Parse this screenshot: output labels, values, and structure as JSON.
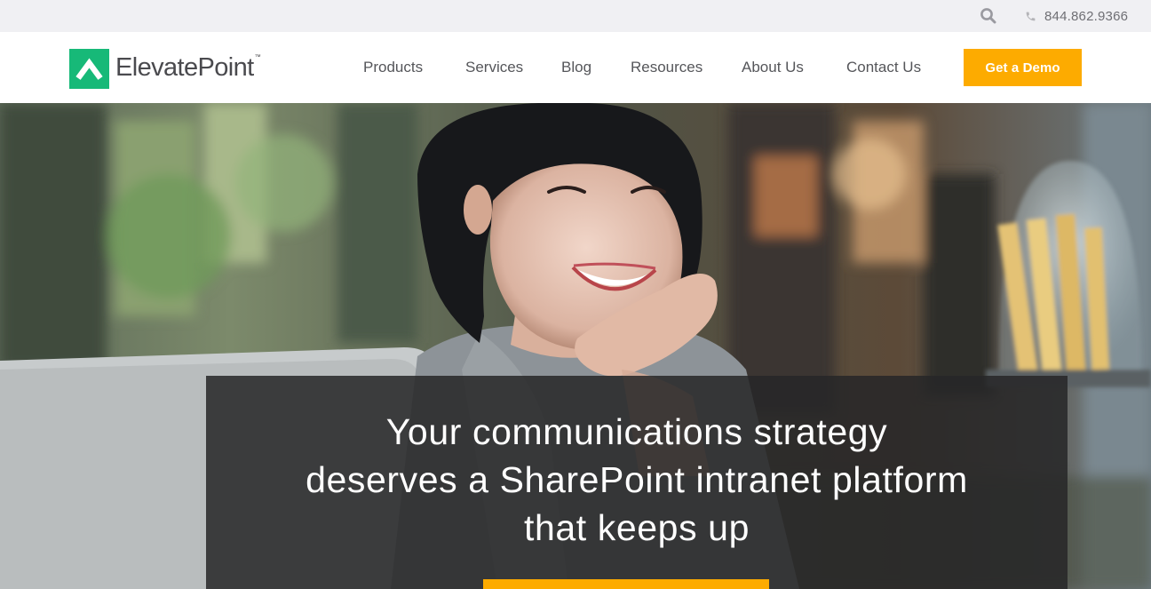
{
  "utility": {
    "phone": "844.862.9366",
    "search_icon": "search-icon",
    "phone_icon": "phone-icon"
  },
  "brand": {
    "name": "ElevatePoint",
    "trademark": "™",
    "color": "#17b978"
  },
  "nav": {
    "items": [
      {
        "label": "Products"
      },
      {
        "label": "Services"
      },
      {
        "label": "Blog"
      },
      {
        "label": "Resources"
      },
      {
        "label": "About Us"
      },
      {
        "label": "Contact Us"
      }
    ],
    "cta_label": "Get a Demo",
    "cta_color": "#fdab00"
  },
  "hero": {
    "headline_lines": [
      "Your communications strategy",
      "deserves a SharePoint intranet platform",
      "that keeps up"
    ]
  }
}
